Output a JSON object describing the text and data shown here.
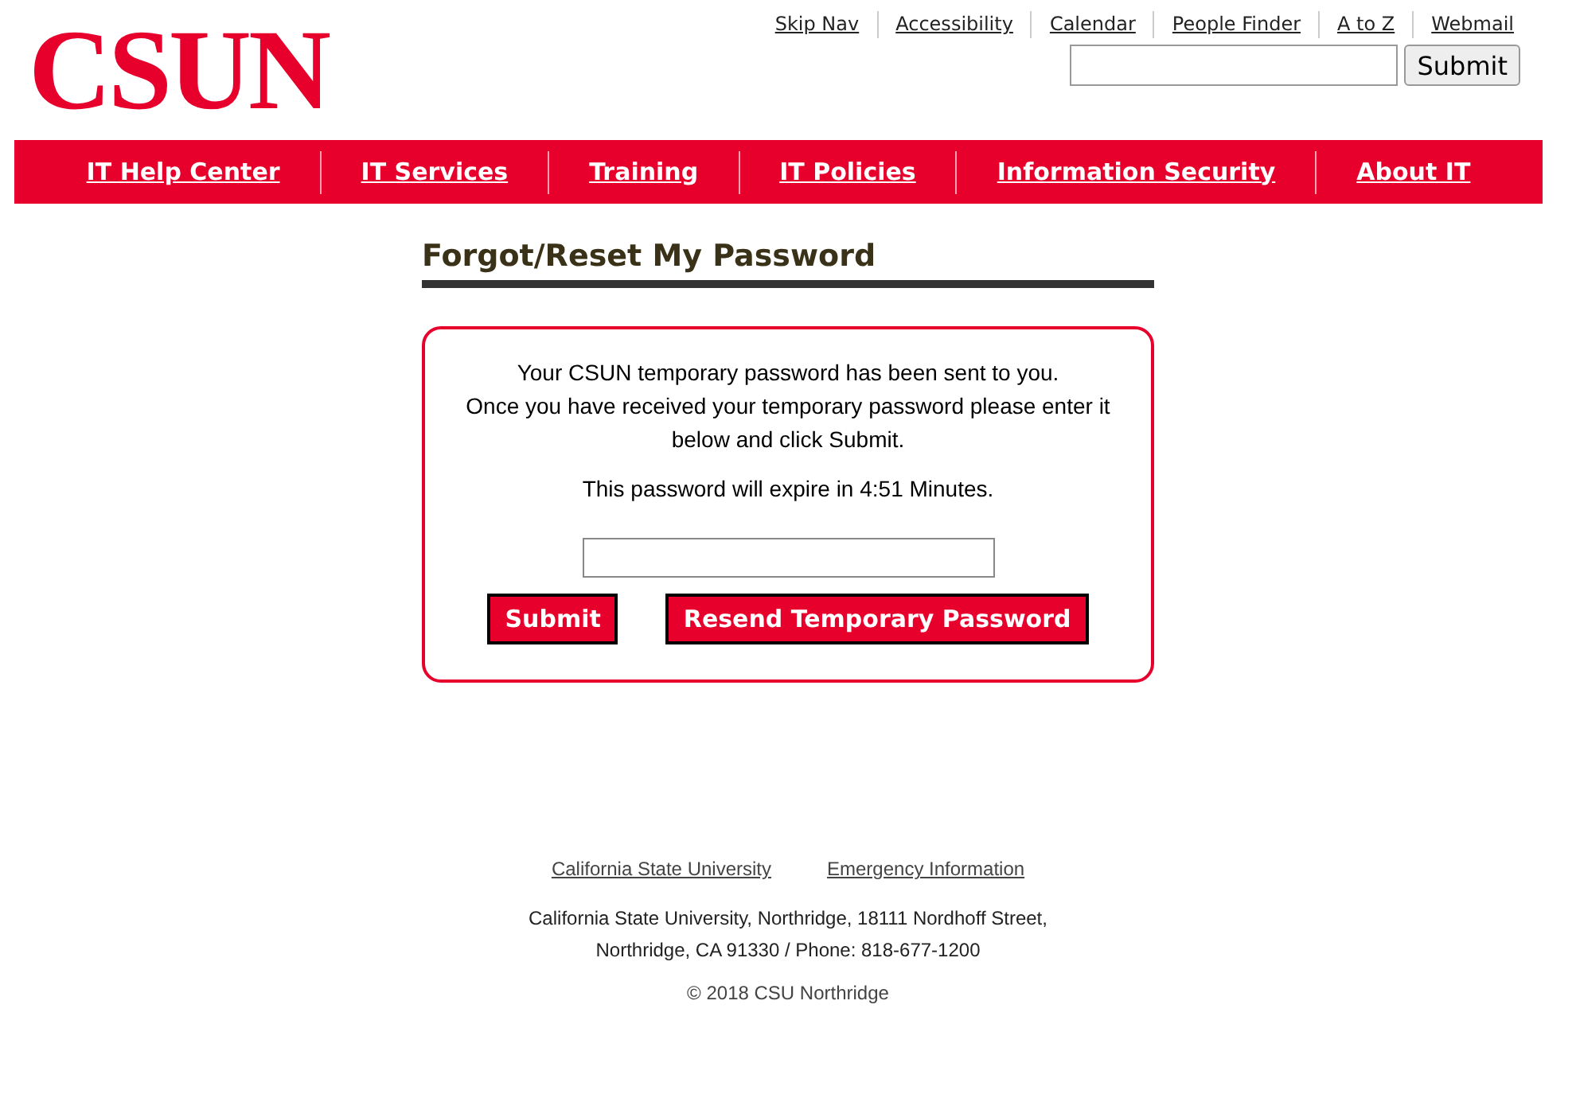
{
  "logo": "CSUN",
  "utility_links": [
    "Skip Nav",
    "Accessibility",
    "Calendar",
    "People Finder",
    "A to Z",
    "Webmail"
  ],
  "site_search": {
    "button": "Submit"
  },
  "nav": [
    "IT Help Center",
    "IT Services",
    "Training",
    "IT Policies",
    "Information Security",
    "About IT"
  ],
  "page_title": "Forgot/Reset My Password",
  "message": [
    "Your CSUN temporary password has been sent to you.",
    "Once you have received your temporary password please enter it below and click Submit."
  ],
  "expiry": "This password will expire in 4:51 Minutes.",
  "buttons": [
    "Submit",
    "Resend Temporary Password"
  ],
  "footer": {
    "links": [
      "California State University",
      "Emergency Information"
    ],
    "address": [
      "California State University, Northridge, 18111 Nordhoff Street,",
      "Northridge, CA 91330 / Phone: 818-677-1200"
    ],
    "copyright": "© 2018 CSU Northridge"
  }
}
